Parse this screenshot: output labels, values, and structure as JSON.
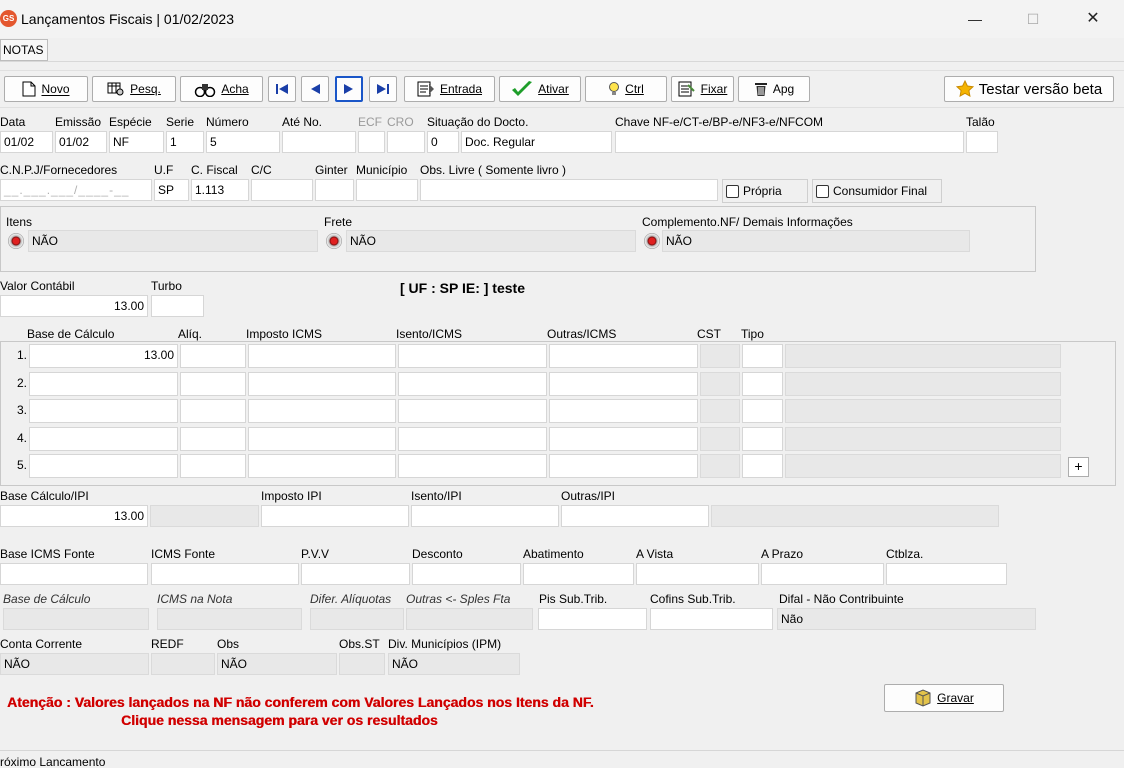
{
  "window": {
    "title": "Lançamentos Fiscais |  01/02/2023",
    "app_icon": "GS",
    "controls": {
      "minimize": "—",
      "maximize": "☐",
      "close": "✕"
    }
  },
  "menu": {
    "notas": "NOTAS"
  },
  "toolbar": {
    "novo": "Novo",
    "pesq": "Pesq.",
    "acha": "Acha",
    "entrada": "Entrada",
    "ativar": "Ativar",
    "ctrl": "Ctrl",
    "fixar": "Fixar",
    "apg": "Apg",
    "testar": "Testar versão beta"
  },
  "header": {
    "labels": {
      "data": "Data",
      "emissao": "Emissão",
      "especie": "Espécie",
      "serie": "Serie",
      "numero": "Número",
      "ate_no": "Até No.",
      "ecf": "ECF",
      "cro": "CRO",
      "situacao": "Situação do Docto.",
      "chave": "Chave NF-e/CT-e/BP-e/NF3-e/NFCOM",
      "talao": "Talão"
    },
    "values": {
      "data": "01/02",
      "emissao": "01/02",
      "especie": "NF",
      "serie": "1",
      "numero": "5",
      "situacao_code": "0",
      "situacao_text": "Doc. Regular"
    }
  },
  "fornecedor": {
    "labels": {
      "cnpj": "C.N.P.J/Fornecedores",
      "uf": "U.F",
      "cfiscal": "C. Fiscal",
      "cc": "C/C",
      "ginter": "Ginter",
      "municipio": "Município",
      "obs_livre": "Obs. Livre ( Somente livro )",
      "propria": "Própria",
      "consumidor": "Consumidor Final"
    },
    "values": {
      "cnpj_mask": "__.___.___/____-__",
      "uf": "SP",
      "cfiscal": "1.113"
    }
  },
  "options": {
    "itens_label": "Itens",
    "itens_value": "NÃO",
    "frete_label": "Frete",
    "frete_value": "NÃO",
    "complemento_label": "Complemento.NF/ Demais Informações",
    "complemento_value": "NÃO"
  },
  "valor": {
    "contabil_label": "Valor Contábil",
    "contabil_value": "13.00",
    "turbo_label": "Turbo",
    "uf_info": "[ UF : SP IE:  ] teste"
  },
  "icms": {
    "headers": {
      "base": "Base de Cálculo",
      "aliq": "Alíq.",
      "imposto": "Imposto ICMS",
      "isento": "Isento/ICMS",
      "outras": "Outras/ICMS",
      "cst": "CST",
      "tipo": "Tipo"
    },
    "rows": [
      {
        "num": "1.",
        "base": "13.00"
      },
      {
        "num": "2.",
        "base": ""
      },
      {
        "num": "3.",
        "base": ""
      },
      {
        "num": "4.",
        "base": ""
      },
      {
        "num": "5.",
        "base": ""
      }
    ],
    "add": "+"
  },
  "ipi": {
    "base_label": "Base Cálculo/IPI",
    "base_value": "13.00",
    "imposto_label": "Imposto IPI",
    "isento_label": "Isento/IPI",
    "outras_label": "Outras/IPI"
  },
  "fonte": {
    "base_label": "Base ICMS Fonte",
    "icms_label": "ICMS Fonte",
    "pvv_label": "P.V.V",
    "desconto_label": "Desconto",
    "abatimento_label": "Abatimento",
    "avista_label": "A Vista",
    "aprazo_label": "A Prazo",
    "ctblza_label": "Ctblza."
  },
  "misc": {
    "base_calc_label": "Base de Cálculo",
    "icms_nota_label": "ICMS na Nota",
    "difer_label": "Difer. Alíquotas",
    "outras_label": "Outras <- Sples Fta",
    "pis_label": "Pis Sub.Trib.",
    "cofins_label": "Cofins Sub.Trib.",
    "difal_label": "Difal - Não Contribuinte",
    "difal_value": "Não"
  },
  "conta": {
    "conta_label": "Conta Corrente",
    "conta_value": "NÃO",
    "redf_label": "REDF",
    "obs_label": "Obs",
    "obs_value": "NÃO",
    "obsst_label": "Obs.ST",
    "div_label": "Div. Municípios (IPM)",
    "div_value": "NÃO"
  },
  "warning": {
    "line1": "Atenção : Valores lançados na NF não conferem com Valores Lançados nos Itens da NF.",
    "line2": "Clique nessa mensagem para ver os resultados"
  },
  "gravar": "Gravar",
  "status": {
    "text": "róximo  Lancamento"
  }
}
